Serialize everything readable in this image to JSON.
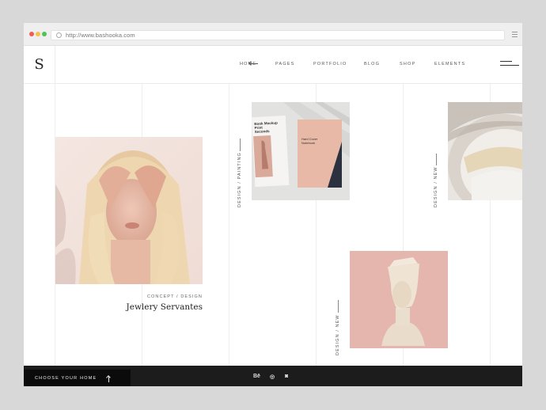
{
  "browser": {
    "url": "http://www.bashooka.com",
    "dots": [
      "#f25c54",
      "#f6c244",
      "#4fc35a"
    ]
  },
  "site": {
    "logo": "S",
    "nav": [
      "HOME",
      "PAGES",
      "PORTFOLIO",
      "BLOG",
      "SHOP",
      "ELEMENTS"
    ]
  },
  "portfolio": {
    "featured": {
      "category": "CONCEPT / DESIGN",
      "title": "Jewlery Servantes"
    },
    "items": [
      {
        "category": "DESIGN / PAINTING",
        "book_text_left": "Book Mockup Print Seconds More Pages",
        "book_text_right": "Hard Cover Notebook"
      },
      {
        "category": "DESIGN / NEW"
      },
      {
        "category": "DESIGN / NEW"
      }
    ]
  },
  "footer": {
    "choose_label": "CHOOSE YOUR HOME",
    "social": [
      "Bē",
      "◎",
      "◙"
    ]
  }
}
